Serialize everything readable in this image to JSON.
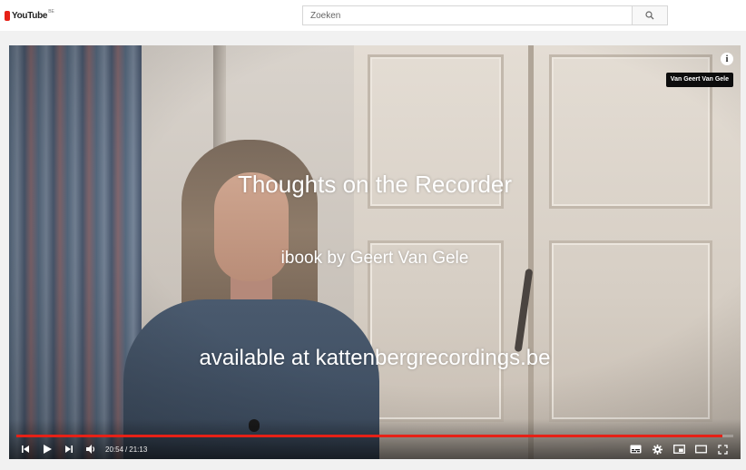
{
  "header": {
    "logo_text": "YouTube",
    "logo_region": "BE",
    "search_placeholder": "Zoeken"
  },
  "video": {
    "overlay_title": "Thoughts on the Recorder",
    "overlay_subtitle": "ibook by Geert Van Gele",
    "overlay_footer": "available at kattenbergrecordings.be",
    "channel_tooltip": "Van Geert Van Gele",
    "current_time": "20:54",
    "duration": "21:13",
    "progress": 0.985
  },
  "colors": {
    "accent": "#e62117",
    "control_bg": "#000000"
  }
}
